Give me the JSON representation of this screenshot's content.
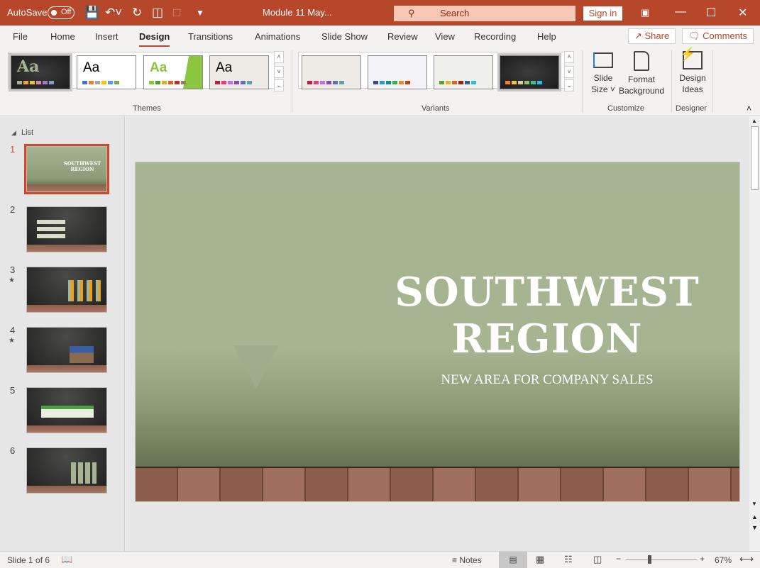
{
  "titlebar": {
    "autosave": "AutoSave",
    "autosave_state": "Off",
    "doc_title": "Module 11 May...",
    "search_placeholder": "Search",
    "sign_in": "Sign in",
    "accent": "#b7472a"
  },
  "tabs": [
    "File",
    "Home",
    "Insert",
    "Design",
    "Transitions",
    "Animations",
    "Slide Show",
    "Review",
    "View",
    "Recording",
    "Help"
  ],
  "active_tab": "Design",
  "share": "Share",
  "comments": "Comments",
  "ribbon": {
    "themes_label": "Themes",
    "variants_label": "Variants",
    "customize_label": "Customize",
    "designer_label": "Designer",
    "theme_sample": "Aa",
    "slide_size": [
      "Slide",
      "Size"
    ],
    "format_background": [
      "Format",
      "Background"
    ],
    "design_ideas": [
      "Design",
      "Ideas"
    ]
  },
  "panel": {
    "section": "List",
    "slides": [
      "1",
      "2",
      "3",
      "4",
      "5",
      "6"
    ]
  },
  "slide": {
    "title_line1": "SOUTHWEST",
    "title_line2": "REGION",
    "subtitle": "NEW AREA FOR COMPANY SALES"
  },
  "status": {
    "slide_info": "Slide 1 of 6",
    "notes": "Notes",
    "zoom": "67%",
    "zoom_percent": 67
  }
}
